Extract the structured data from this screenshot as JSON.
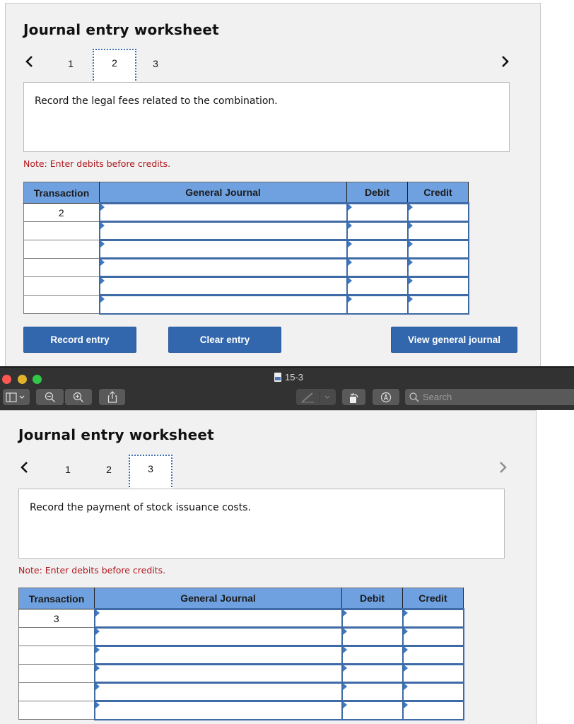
{
  "worksheets": [
    {
      "title": "Journal entry worksheet",
      "pager": {
        "prev_icon": "chevron-left-icon",
        "next_icon": "chevron-right-icon",
        "pages": [
          "1",
          "2",
          "3"
        ],
        "active_page": "2",
        "next_enabled": true
      },
      "prompt": "Record the legal fees related to the combination.",
      "note": "Note: Enter debits before credits.",
      "table": {
        "headers": [
          "Transaction",
          "General Journal",
          "Debit",
          "Credit"
        ],
        "rows": [
          {
            "transaction": "2",
            "account": "",
            "debit": "",
            "credit": ""
          },
          {
            "transaction": "",
            "account": "",
            "debit": "",
            "credit": ""
          },
          {
            "transaction": "",
            "account": "",
            "debit": "",
            "credit": ""
          },
          {
            "transaction": "",
            "account": "",
            "debit": "",
            "credit": ""
          },
          {
            "transaction": "",
            "account": "",
            "debit": "",
            "credit": ""
          },
          {
            "transaction": "",
            "account": "",
            "debit": "",
            "credit": ""
          }
        ]
      },
      "buttons": {
        "record": "Record entry",
        "clear": "Clear entry",
        "view": "View general journal"
      }
    },
    {
      "title": "Journal entry worksheet",
      "pager": {
        "prev_icon": "chevron-left-icon",
        "next_icon": "chevron-right-icon",
        "pages": [
          "1",
          "2",
          "3"
        ],
        "active_page": "3",
        "next_enabled": false
      },
      "prompt": "Record the payment of stock issuance costs.",
      "note": "Note: Enter debits before credits.",
      "table": {
        "headers": [
          "Transaction",
          "General Journal",
          "Debit",
          "Credit"
        ],
        "rows": [
          {
            "transaction": "3",
            "account": "",
            "debit": "",
            "credit": ""
          },
          {
            "transaction": "",
            "account": "",
            "debit": "",
            "credit": ""
          },
          {
            "transaction": "",
            "account": "",
            "debit": "",
            "credit": ""
          },
          {
            "transaction": "",
            "account": "",
            "debit": "",
            "credit": ""
          },
          {
            "transaction": "",
            "account": "",
            "debit": "",
            "credit": ""
          },
          {
            "transaction": "",
            "account": "",
            "debit": "",
            "credit": ""
          }
        ]
      }
    }
  ],
  "viewer": {
    "document_title": "15-3",
    "traffic_lights": {
      "close": "#fc5753",
      "minimize": "#e0b32a",
      "zoom": "#33c748"
    },
    "toolbar": {
      "sidebar_icon": "sidebar-toggle-icon",
      "zoom_out_icon": "zoom-out-icon",
      "zoom_in_icon": "zoom-in-icon",
      "share_icon": "share-icon",
      "markup_icon": "pen-markup-icon",
      "rotate_icon": "rotate-icon",
      "annotate_icon": "annotate-icon",
      "search_placeholder": "Search"
    }
  },
  "colors": {
    "header_blue": "#6fa1e0",
    "button_blue": "#3266ad",
    "note_red": "#b0181d",
    "cell_border": "#3e6aa5"
  }
}
